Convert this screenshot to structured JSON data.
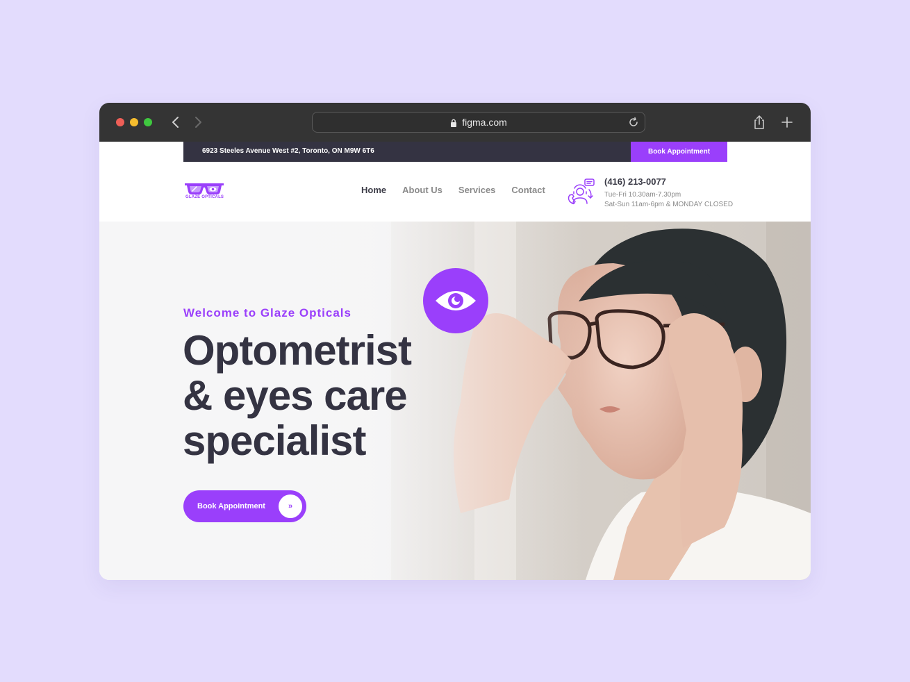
{
  "browser": {
    "url": "figma.com",
    "traffic_lights": [
      "#ee5f57",
      "#f6bd2e",
      "#3fc83f"
    ]
  },
  "topbar": {
    "address": "6923 Steeles Avenue West #2, Toronto, ON M9W 6T6",
    "book_label": "Book Appointment"
  },
  "brand": {
    "name": "GLAZE OPTICALS",
    "color": "#9a3ffb"
  },
  "nav": {
    "items": [
      {
        "label": "Home",
        "active": true
      },
      {
        "label": "About Us"
      },
      {
        "label": "Services"
      },
      {
        "label": "Contact"
      }
    ]
  },
  "contact": {
    "phone": "(416) 213-0077",
    "hours_weekday": "Tue-Fri 10.30am-7.30pm",
    "hours_weekend": "Sat-Sun 11am-6pm & MONDAY CLOSED",
    "icon": "support-agent-icon"
  },
  "hero": {
    "welcome": "Welcome to Glaze Opticals",
    "headline_line1": "Optometrist",
    "headline_line2": "& eyes care",
    "headline_line3": "specialist",
    "cta_label": "Book Appointment",
    "cta_icon": "»",
    "badge_icon": "eye-icon"
  }
}
